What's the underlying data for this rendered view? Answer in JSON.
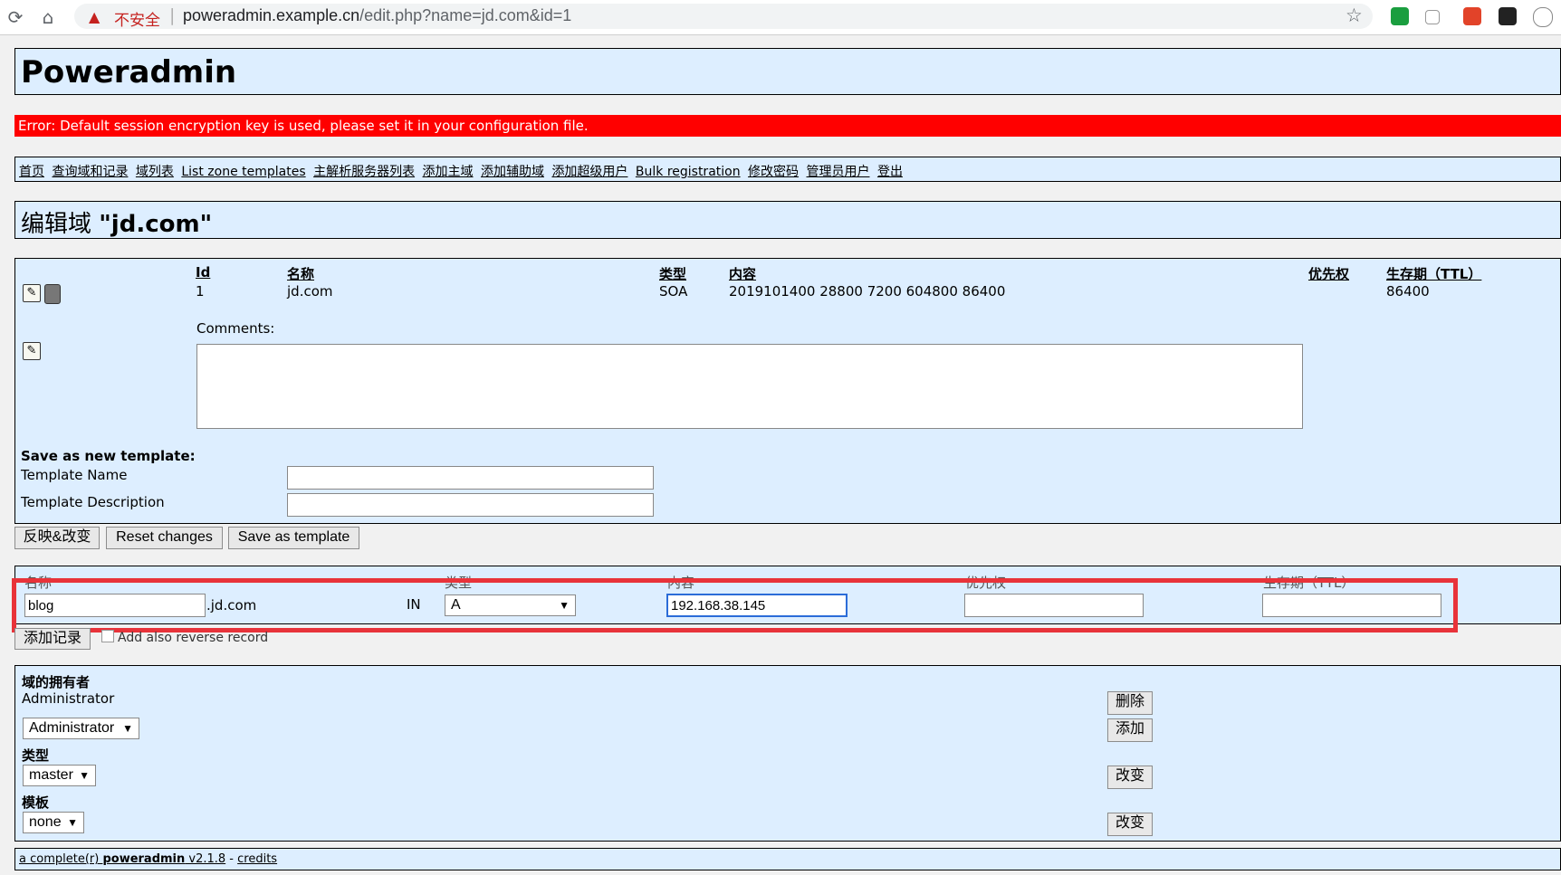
{
  "browser": {
    "insecure_label": "不安全",
    "url_host": "poweradmin.example.cn",
    "url_path": "/edit.php?name=jd.com&id=1"
  },
  "app": {
    "title": "Poweradmin"
  },
  "error": "Error: Default session encryption key is used, please set it in your configuration file.",
  "menu": [
    "首页",
    "查询域和记录",
    "域列表",
    "List zone templates",
    "主解析服务器列表",
    "添加主域",
    "添加辅助域",
    "添加超级用户",
    "Bulk registration",
    "修改密码",
    "管理员用户",
    "登出"
  ],
  "zone_heading": {
    "prefix": "编辑域 ",
    "name": "\"jd.com\""
  },
  "records": {
    "headers": {
      "id": "Id",
      "name": "名称",
      "type": "类型",
      "content": "内容",
      "priority": "优先权",
      "ttl": "生存期（TTL）"
    },
    "rows": [
      {
        "id": "1",
        "name": "jd.com",
        "type": "SOA",
        "content": "2019101400 28800 7200 604800 86400",
        "priority": "",
        "ttl": "86400"
      }
    ],
    "comments_label": "Comments:",
    "comments_value": ""
  },
  "template_form": {
    "heading": "Save as new template:",
    "name_label": "Template Name",
    "desc_label": "Template Description",
    "name_value": "",
    "desc_value": ""
  },
  "buttons": {
    "apply": "反映&改变",
    "reset": "Reset changes",
    "save_template": "Save as template",
    "add_record": "添加记录",
    "delete": "删除",
    "add": "添加",
    "change1": "改变",
    "change2": "改变"
  },
  "add_record": {
    "headers": {
      "name": "名称",
      "type": "类型",
      "content": "内容",
      "priority": "优先权",
      "ttl": "生存期（TTL）"
    },
    "name_value": "blog",
    "domain_suffix": ".jd.com",
    "class": "IN",
    "type_value": "A",
    "content_value": "192.168.38.145",
    "priority_value": "",
    "ttl_value": "",
    "reverse_label": "Add also reverse record"
  },
  "owner": {
    "owner_label": "域的拥有者",
    "owner_name": "Administrator",
    "owner_select": "Administrator",
    "type_label": "类型",
    "type_select": "master",
    "template_label": "模板",
    "template_select": "none"
  },
  "footer": {
    "prefix": "a complete(r) ",
    "app": "poweradmin",
    "version": " v2.1.8",
    "sep": " - ",
    "credits": "credits"
  }
}
